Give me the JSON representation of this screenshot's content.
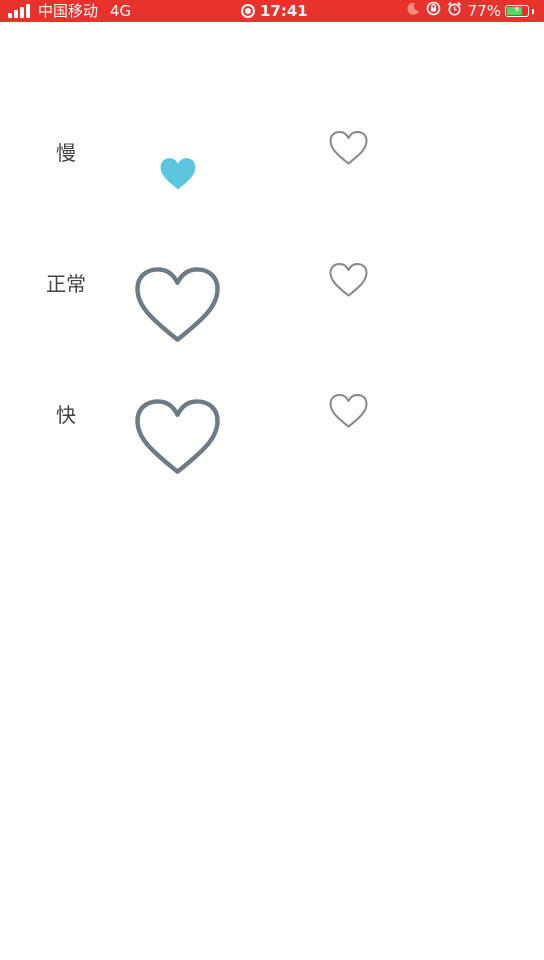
{
  "status_bar": {
    "carrier": "中国移动",
    "network": "4G",
    "time": "17:41",
    "battery_percent": "77%",
    "battery_level": 0.77,
    "background_color": "#e8322c"
  },
  "rows": [
    {
      "label": "慢",
      "heart_state": "filled",
      "heart_color": "#5bc6de"
    },
    {
      "label": "正常",
      "heart_state": "outline",
      "heart_color": "#6e7b82"
    },
    {
      "label": "快",
      "heart_state": "outline",
      "heart_color": "#6e7b82"
    }
  ],
  "static_heart_color": "#888888",
  "icons": [
    "signal-icon",
    "record-icon",
    "moon-icon",
    "rotation-lock-icon",
    "alarm-icon",
    "battery-icon",
    "heart-icon"
  ]
}
